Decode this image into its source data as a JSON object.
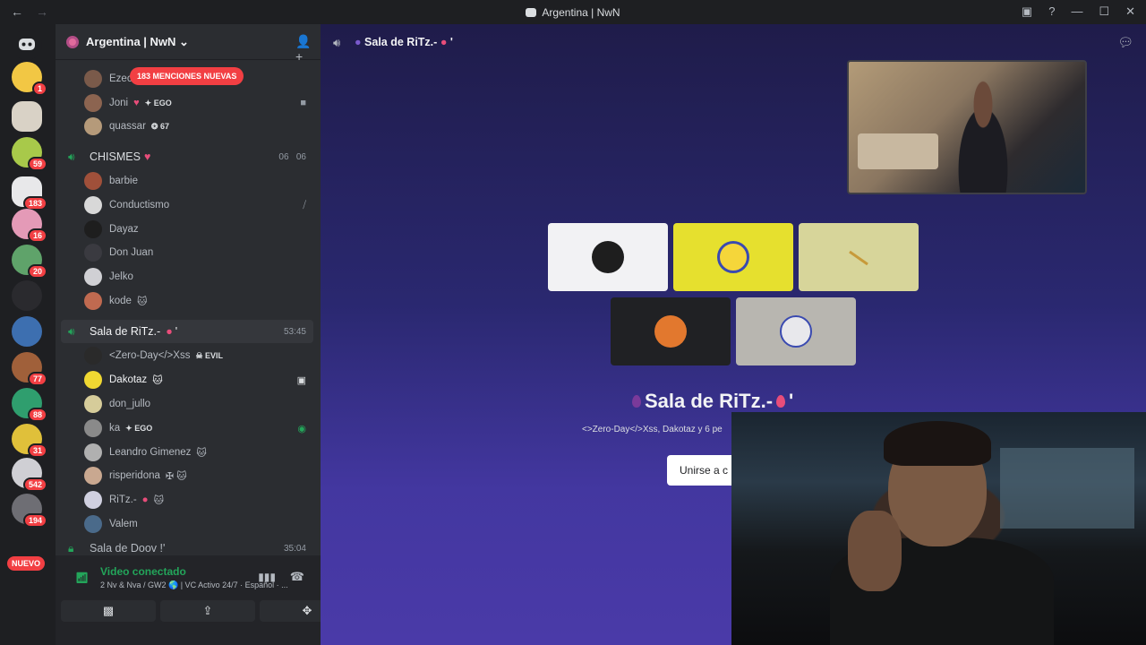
{
  "window": {
    "title": "Argentina | NwN"
  },
  "server": {
    "name": "Argentina | NwN",
    "mentions_label": "183 MENCIONES NUEVAS"
  },
  "guild_badges": [
    "1",
    "59",
    "183",
    "16",
    "20",
    "77",
    "88",
    "31",
    "542",
    "194"
  ],
  "guild_new_label": "NUEVO",
  "top_users": [
    {
      "name": "Ezec",
      "tag": ""
    },
    {
      "name": "Joni",
      "tag": "EGO"
    },
    {
      "name": "quassar",
      "tag": "67"
    }
  ],
  "channel_chismes": {
    "name": "CHISMES",
    "count_a": "06",
    "count_b": "06",
    "members": [
      "barbie",
      "Conductismo",
      "Dayaz",
      "Don Juan",
      "Jelko",
      "kode"
    ]
  },
  "channel_ritz": {
    "name": "Sala de RiTz.-",
    "suffix": "'",
    "time": "53:45",
    "members": [
      {
        "name": "<Zero-Day</>Xss",
        "tag": "EVIL"
      },
      {
        "name": "Dakotaz",
        "tag": ""
      },
      {
        "name": "don_jullo",
        "tag": ""
      },
      {
        "name": "ka",
        "tag": "EGO"
      },
      {
        "name": "Leandro Gimenez",
        "tag": ""
      },
      {
        "name": "risperidona",
        "tag": ""
      },
      {
        "name": "RiTz.-",
        "tag": ""
      },
      {
        "name": "Valem",
        "tag": ""
      }
    ]
  },
  "channel_next": {
    "name": "Sala de Doov !'",
    "time": "35:04"
  },
  "panel": {
    "status": "Video conectado",
    "subtitle": "2 Nv & Nva / GW2 🌎 | VC Activo 24/7 · Español · ..."
  },
  "stage": {
    "channel_title": "Sala de RiTz.-",
    "title": "Sala de RiTz.-",
    "title_suffix": "'",
    "participants_text": "<>Zero-Day</>Xss, Dakotaz y 6 pe",
    "join_label": "Unirse a c"
  },
  "colors": {
    "accent_red": "#f23f43",
    "online_green": "#23a55a",
    "stage_bg_top": "#1f1c4a",
    "stage_bg_bottom": "#4a3aa8"
  },
  "icons": [
    "back-arrow-icon",
    "forward-arrow-icon",
    "discord-logo-icon",
    "add-member-icon",
    "speaker-icon",
    "chat-icon",
    "help-icon",
    "minimize-icon",
    "maximize-icon",
    "close-icon",
    "hangup-icon",
    "camera-off-icon",
    "screen-share-icon",
    "activities-icon"
  ]
}
